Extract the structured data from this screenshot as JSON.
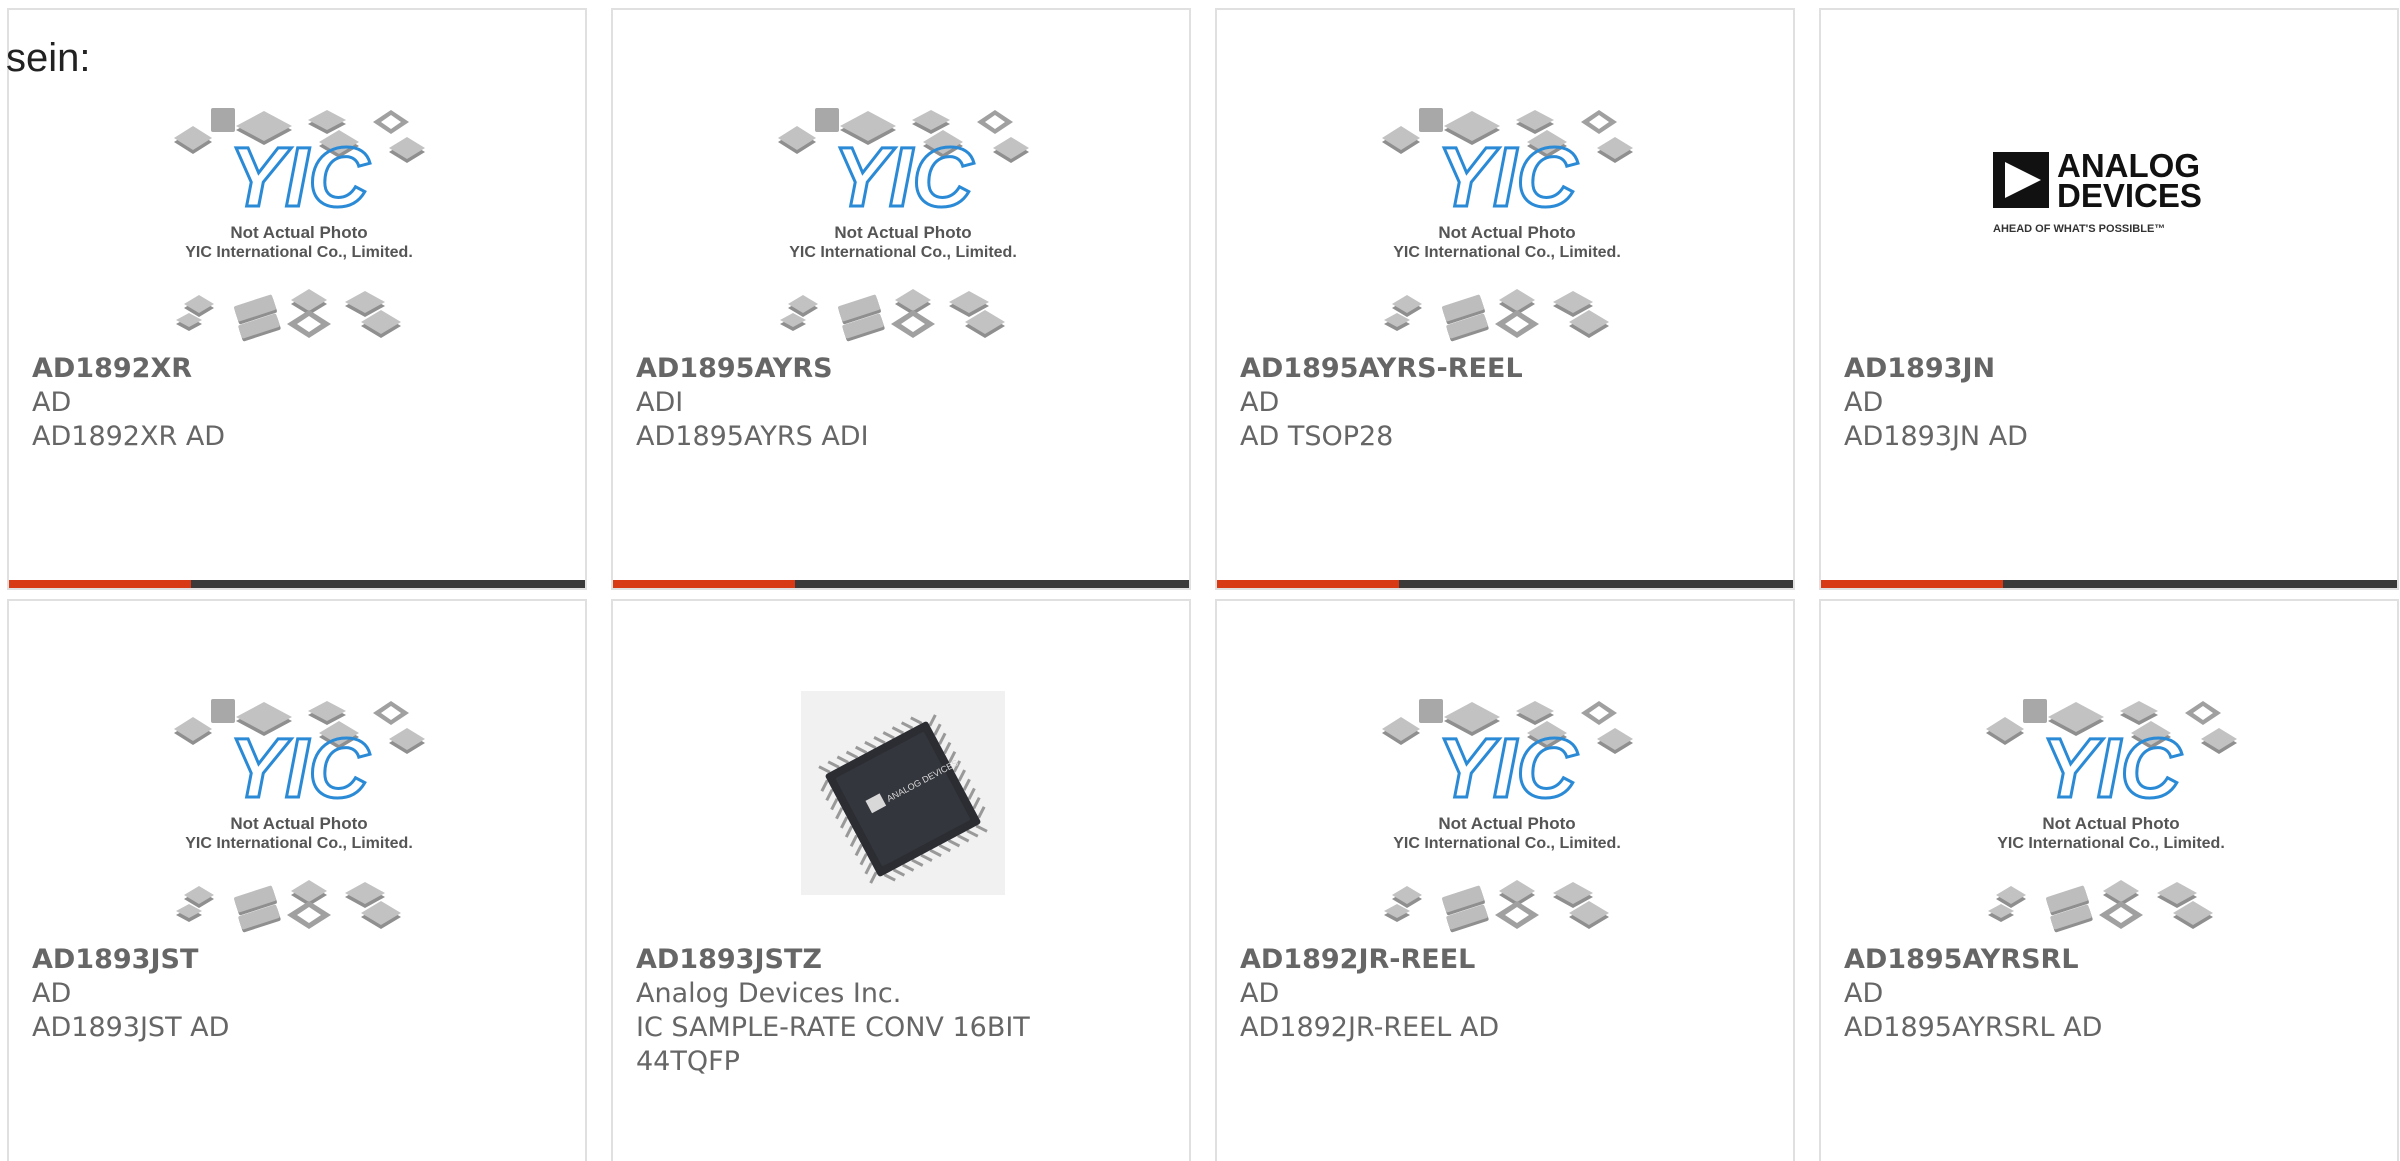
{
  "intro_text": "sein:",
  "placeholder": {
    "line1": "Not Actual Photo",
    "line2": "YIC International Co., Limited.",
    "logo": "YIC"
  },
  "adi_logo": {
    "line1": "ANALOG",
    "line2": "DEVICES",
    "tagline": "AHEAD OF WHAT'S POSSIBLE™"
  },
  "chip_marking": "ANALOG DEVICES",
  "colors": {
    "accent": "#d93a16",
    "bar": "#3a3a3a",
    "text": "#666666",
    "yic_blue": "#2a8ad6",
    "border": "#e0e0e0"
  },
  "products": [
    {
      "part": "AD1892XR",
      "manufacturer": "AD",
      "description": "AD1892XR AD",
      "image": "placeholder"
    },
    {
      "part": "AD1895AYRS",
      "manufacturer": "ADI",
      "description": "AD1895AYRS ADI",
      "image": "placeholder"
    },
    {
      "part": "AD1895AYRS-REEL",
      "manufacturer": "AD",
      "description": "AD TSOP28",
      "image": "placeholder"
    },
    {
      "part": "AD1893JN",
      "manufacturer": "AD",
      "description": "AD1893JN AD",
      "image": "adi-logo"
    },
    {
      "part": "AD1893JST",
      "manufacturer": "AD",
      "description": "AD1893JST AD",
      "image": "placeholder"
    },
    {
      "part": "AD1893JSTZ",
      "manufacturer": "Analog Devices Inc.",
      "description": "IC SAMPLE-RATE CONV 16BIT 44TQFP",
      "image": "chip"
    },
    {
      "part": "AD1892JR-REEL",
      "manufacturer": "AD",
      "description": "AD1892JR-REEL AD",
      "image": "placeholder"
    },
    {
      "part": "AD1895AYRSRL",
      "manufacturer": "AD",
      "description": "AD1895AYRSRL AD",
      "image": "placeholder"
    }
  ]
}
